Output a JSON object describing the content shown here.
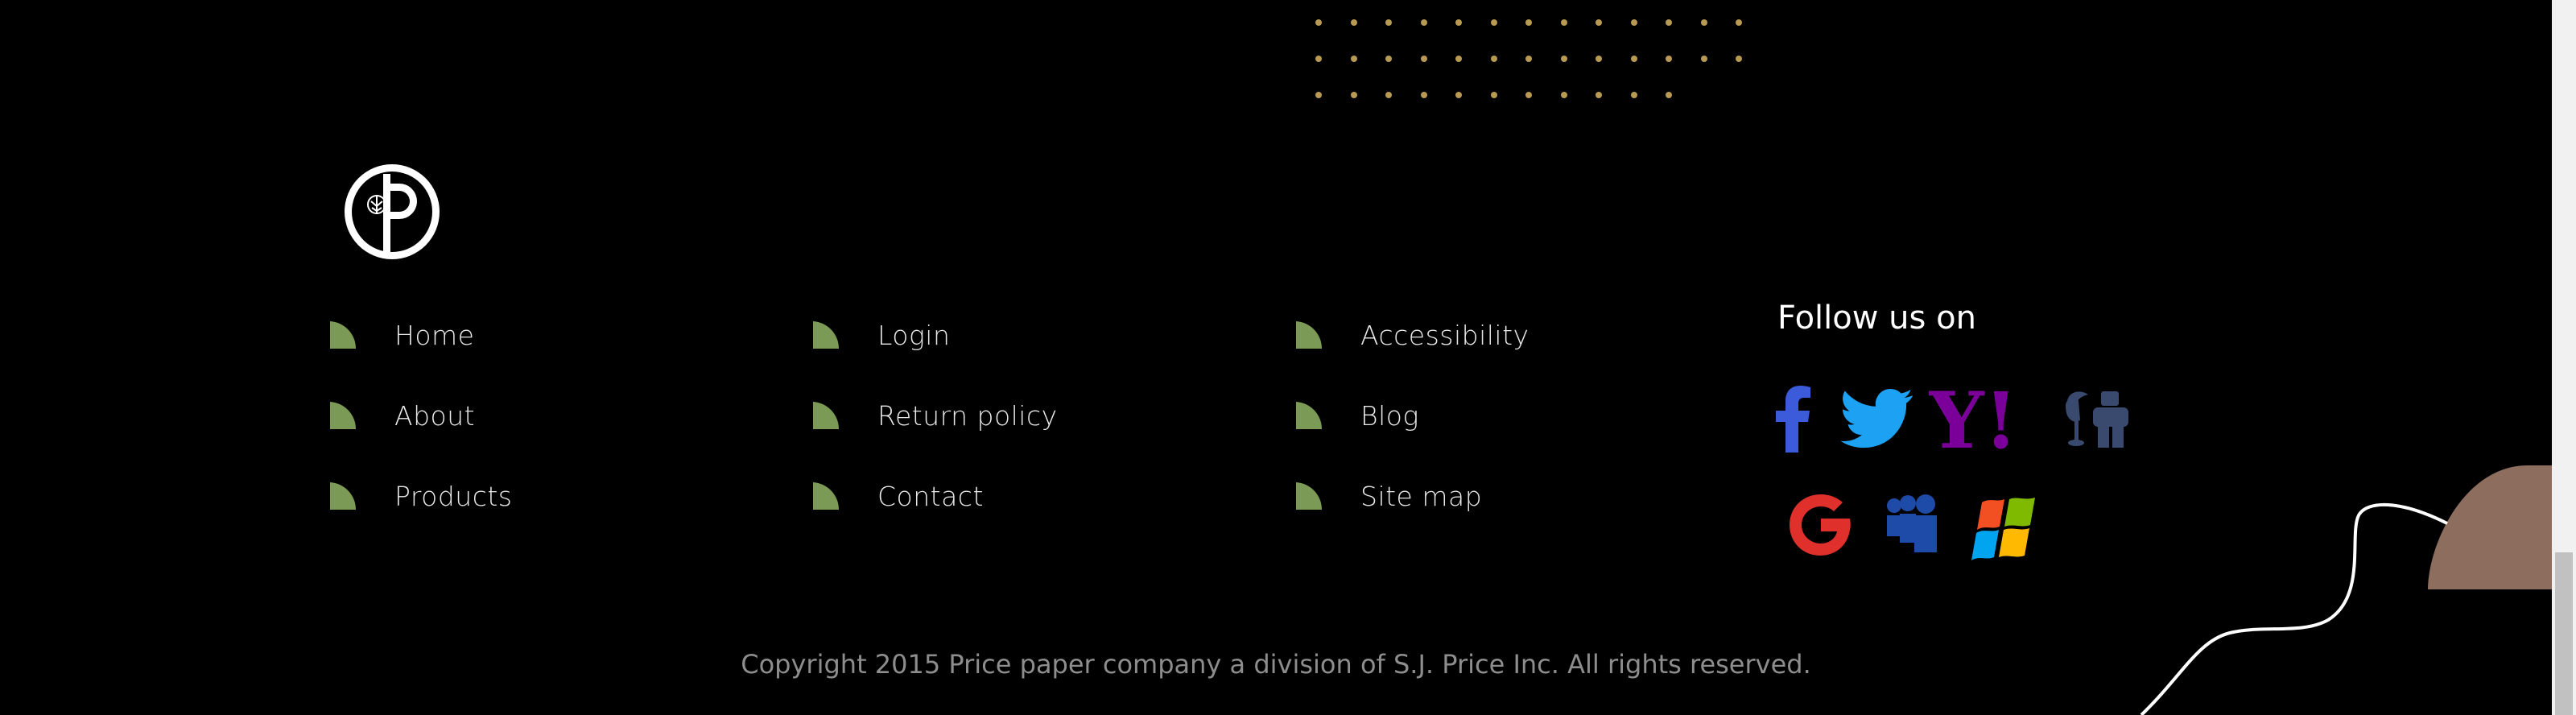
{
  "logo": {
    "icon": "pp-monogram-logo"
  },
  "nav": {
    "col1": [
      {
        "label": "Home"
      },
      {
        "label": "About"
      },
      {
        "label": "Products"
      }
    ],
    "col2": [
      {
        "label": "Login"
      },
      {
        "label": "Return policy"
      },
      {
        "label": "Contact"
      }
    ],
    "col3": [
      {
        "label": "Accessibility"
      },
      {
        "label": "Blog"
      },
      {
        "label": "Site map"
      }
    ]
  },
  "social": {
    "heading": "Follow us on",
    "links": [
      {
        "icon": "facebook-icon",
        "color": "#3b5bdb"
      },
      {
        "icon": "twitter-icon",
        "color": "#1da1f2"
      },
      {
        "icon": "yahoo-icon",
        "color": "#7b0099"
      },
      {
        "icon": "digg-icon",
        "color": "#3a4a6e"
      },
      {
        "icon": "google-icon",
        "color": "#e0302b"
      },
      {
        "icon": "myspace-icon",
        "color": "#1f4ba8"
      },
      {
        "icon": "windows-icon",
        "colors": [
          "#f25022",
          "#7fba00",
          "#00a4ef",
          "#ffb900"
        ]
      }
    ]
  },
  "copyright": "Copyright 2015 Price paper company a division of S.J. Price Inc. All rights reserved.",
  "theme": {
    "bullet": "#7a9a55",
    "dots": "#b89a52",
    "accent_shape": "#8c6d5e"
  }
}
